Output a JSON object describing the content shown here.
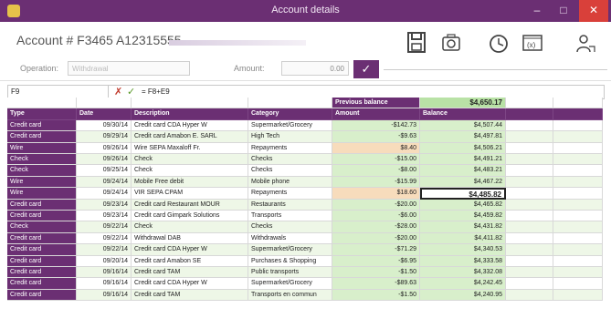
{
  "window": {
    "title": "Account details",
    "controls": {
      "minimize": "–",
      "maximize": "□",
      "close": "✕"
    }
  },
  "header": {
    "account_label": "Account # F3465 A12315555"
  },
  "toolbar": {
    "icons": [
      "save-icon",
      "camera-icon",
      "clock-icon",
      "formula-box-icon",
      "users-icon"
    ]
  },
  "operation": {
    "operation_label": "Operation:",
    "operation_value": "Withdrawal",
    "amount_label": "Amount:",
    "amount_value": "0.00",
    "ok_label": "✓"
  },
  "formula_bar": {
    "cell": "F9",
    "cancel": "✗",
    "accept": "✓",
    "formula": "= F8+E9"
  },
  "colors": {
    "accent": "#6b2f73",
    "green": "#d8efcb",
    "orange": "#f7dcbc"
  },
  "table": {
    "previous_balance_label": "Previous balance",
    "previous_balance_value": "$4,650.17",
    "columns": [
      "Type",
      "Date",
      "Description",
      "Category",
      "Amount",
      "Balance"
    ],
    "rows": [
      {
        "type": "Credit card",
        "date": "09/30/14",
        "desc": "Credit card CDA Hyper W",
        "cat": "Supermarket/Grocery",
        "amount": "-$142.73",
        "balance": "$4,507.44",
        "kind": "neg"
      },
      {
        "type": "Credit card",
        "date": "09/29/14",
        "desc": "Credit card Amabon E. SARL",
        "cat": "High Tech",
        "amount": "-$9.63",
        "balance": "$4,497.81",
        "kind": "neg"
      },
      {
        "type": "Wire",
        "date": "09/26/14",
        "desc": "Wire SEPA Maxaloff Fr.",
        "cat": "Repayments",
        "amount": "$8.40",
        "balance": "$4,506.21",
        "kind": "pos"
      },
      {
        "type": "Check",
        "date": "09/26/14",
        "desc": "Check",
        "cat": "Checks",
        "amount": "-$15.00",
        "balance": "$4,491.21",
        "kind": "neg"
      },
      {
        "type": "Check",
        "date": "09/25/14",
        "desc": "Check",
        "cat": "Checks",
        "amount": "-$8.00",
        "balance": "$4,483.21",
        "kind": "neg"
      },
      {
        "type": "Wire",
        "date": "09/24/14",
        "desc": "Mobile Free debit",
        "cat": "Mobile phone",
        "amount": "-$15.99",
        "balance": "$4,467.22",
        "kind": "neg"
      },
      {
        "type": "Wire",
        "date": "09/24/14",
        "desc": "VIR SEPA CPAM",
        "cat": "Repayments",
        "amount": "$18.60",
        "balance": "$4,485.82",
        "kind": "pos",
        "selected": true
      },
      {
        "type": "Credit card",
        "date": "09/23/14",
        "desc": "Credit card Restaurant MOUR",
        "cat": "Restaurants",
        "amount": "-$20.00",
        "balance": "$4,465.82",
        "kind": "neg"
      },
      {
        "type": "Credit card",
        "date": "09/23/14",
        "desc": "Credit card Gimpark Solutions",
        "cat": "Transports",
        "amount": "-$6.00",
        "balance": "$4,459.82",
        "kind": "neg"
      },
      {
        "type": "Check",
        "date": "09/22/14",
        "desc": "Check",
        "cat": "Checks",
        "amount": "-$28.00",
        "balance": "$4,431.82",
        "kind": "neg"
      },
      {
        "type": "Credit card",
        "date": "09/22/14",
        "desc": "Withdrawal DAB",
        "cat": "Withdrawals",
        "amount": "-$20.00",
        "balance": "$4,411.82",
        "kind": "neg"
      },
      {
        "type": "Credit card",
        "date": "09/22/14",
        "desc": "Credit card CDA Hyper W",
        "cat": "Supermarket/Grocery",
        "amount": "-$71.29",
        "balance": "$4,340.53",
        "kind": "neg"
      },
      {
        "type": "Credit card",
        "date": "09/20/14",
        "desc": "Credit card Amabon SE",
        "cat": "Purchases & Shopping",
        "amount": "-$6.95",
        "balance": "$4,333.58",
        "kind": "neg"
      },
      {
        "type": "Credit card",
        "date": "09/16/14",
        "desc": "Credit card TAM",
        "cat": "Public transports",
        "amount": "-$1.50",
        "balance": "$4,332.08",
        "kind": "neg"
      },
      {
        "type": "Credit card",
        "date": "09/16/14",
        "desc": "Credit card CDA Hyper W",
        "cat": "Supermarket/Grocery",
        "amount": "-$89.63",
        "balance": "$4,242.45",
        "kind": "neg"
      },
      {
        "type": "Credit card",
        "date": "09/16/14",
        "desc": "Credit card TAM",
        "cat": "Transports en commun",
        "amount": "-$1.50",
        "balance": "$4,240.95",
        "kind": "neg"
      }
    ]
  }
}
